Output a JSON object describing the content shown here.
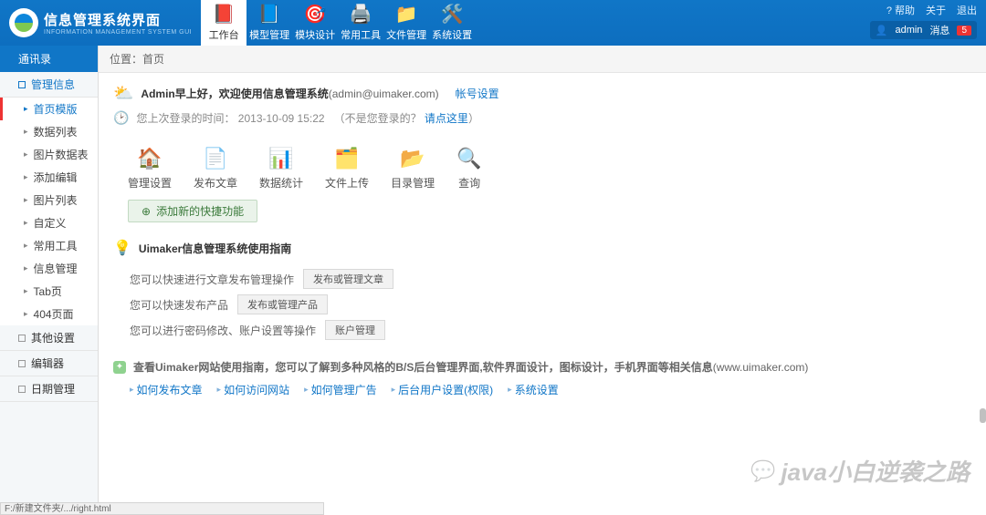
{
  "header": {
    "logo_title": "信息管理系统界面",
    "logo_sub": "INFORMATION MANAGEMENT SYSTEM GUI",
    "nav": [
      {
        "label": "工作台",
        "icon": "📕",
        "active": true
      },
      {
        "label": "模型管理",
        "icon": "📘"
      },
      {
        "label": "模块设计",
        "icon": "🎯"
      },
      {
        "label": "常用工具",
        "icon": "🖨️"
      },
      {
        "label": "文件管理",
        "icon": "📁"
      },
      {
        "label": "系统设置",
        "icon": "🛠️"
      }
    ],
    "top_links": {
      "help": "帮助",
      "about": "关于",
      "exit": "退出"
    },
    "user": {
      "name": "admin",
      "msg_label": "消息",
      "msg_count": "5"
    }
  },
  "sidebar": {
    "title": "通讯录",
    "sections": [
      {
        "label": "管理信息",
        "open": true,
        "items": [
          {
            "label": "首页模版",
            "active": true
          },
          {
            "label": "数据列表"
          },
          {
            "label": "图片数据表"
          },
          {
            "label": "添加编辑"
          },
          {
            "label": "图片列表"
          },
          {
            "label": "自定义"
          },
          {
            "label": "常用工具"
          },
          {
            "label": "信息管理"
          },
          {
            "label": "Tab页"
          },
          {
            "label": "404页面"
          }
        ]
      },
      {
        "label": "其他设置"
      },
      {
        "label": "编辑器"
      },
      {
        "label": "日期管理"
      }
    ]
  },
  "crumb": {
    "label": "位置：",
    "page": "首页"
  },
  "welcome": {
    "text": "Admin早上好，欢迎使用信息管理系统",
    "email": "(admin@uimaker.com)",
    "account": "帐号设置"
  },
  "lastlogin": {
    "text": "您上次登录的时间：",
    "time": "2013-10-09 15:22",
    "note": "（不是您登录的？",
    "link": "请点这里",
    "close": "）"
  },
  "quick": [
    {
      "label": "管理设置",
      "icon": "🏠"
    },
    {
      "label": "发布文章",
      "icon": "📄"
    },
    {
      "label": "数据统计",
      "icon": "📊"
    },
    {
      "label": "文件上传",
      "icon": "🗂️"
    },
    {
      "label": "目录管理",
      "icon": "📂"
    },
    {
      "label": "查询",
      "icon": "🔍"
    }
  ],
  "add_quick": "添加新的快捷功能",
  "guide": {
    "title": "Uimaker信息管理系统使用指南",
    "rows": [
      {
        "text": "您可以快速进行文章发布管理操作",
        "btn": "发布或管理文章"
      },
      {
        "text": "您可以快速发布产品",
        "btn": "发布或管理产品"
      },
      {
        "text": "您可以进行密码修改、账户设置等操作",
        "btn": "账户管理"
      }
    ]
  },
  "tips": {
    "headline": "查看Uimaker网站使用指南，您可以了解到多种风格的B/S后台管理界面,软件界面设计，图标设计，手机界面等相关信息",
    "headline_url": "(www.uimaker.com)",
    "links": [
      "如何发布文章",
      "如何访问网站",
      "如何管理广告",
      "后台用户设置(权限)",
      "系统设置"
    ]
  },
  "watermark": "java小白逆袭之路",
  "statusbar": "F:/新建文件夹/.../right.html"
}
